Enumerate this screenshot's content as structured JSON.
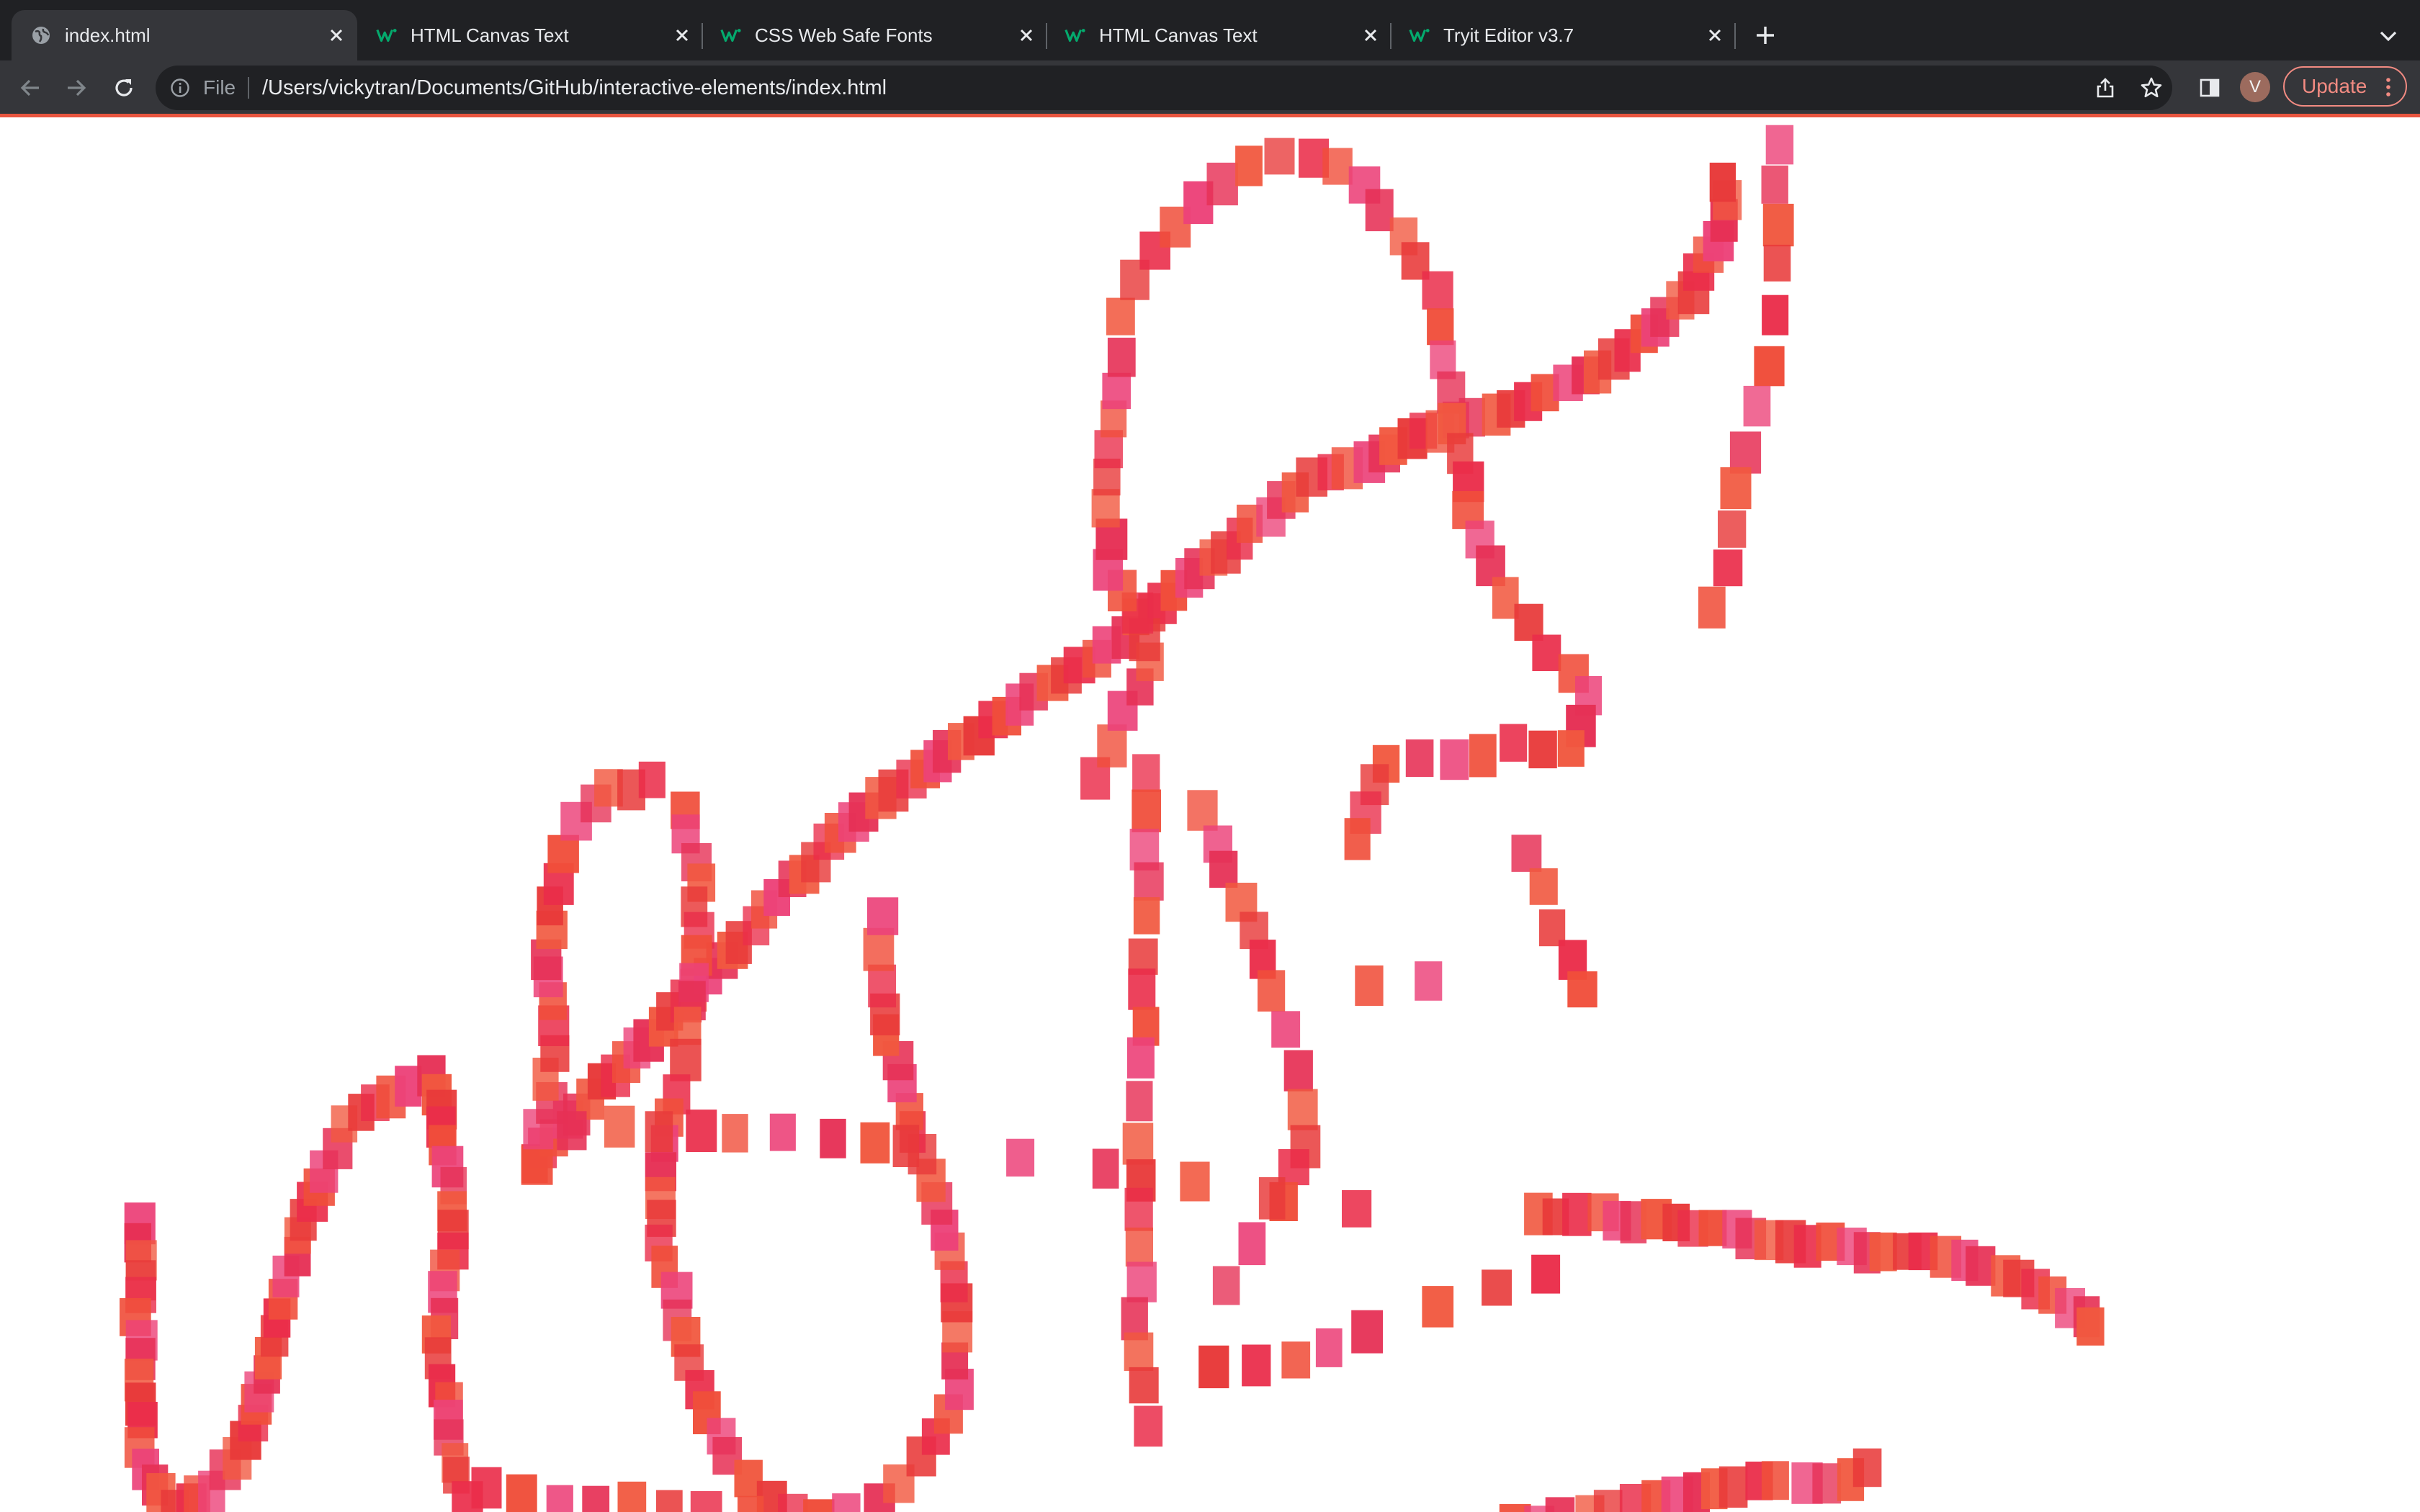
{
  "tabs": [
    {
      "title": "index.html",
      "favicon": "globe-icon",
      "active": true
    },
    {
      "title": "HTML Canvas Text",
      "favicon": "w3schools-icon",
      "active": false
    },
    {
      "title": "CSS Web Safe Fonts",
      "favicon": "w3schools-icon",
      "active": false
    },
    {
      "title": "HTML Canvas Text",
      "favicon": "w3schools-icon",
      "active": false
    },
    {
      "title": "Tryit Editor v3.7",
      "favicon": "w3schools-icon",
      "active": false
    }
  ],
  "toolbar": {
    "back_icon": "arrow-left-icon",
    "forward_icon": "arrow-right-icon",
    "reload_icon": "reload-icon",
    "scheme_label": "File",
    "url": "/Users/vickytran/Documents/GitHub/interactive-elements/index.html",
    "avatar_initial": "V",
    "update_label": "Update"
  },
  "colors": {
    "tabstrip": "#202124",
    "toolbar": "#35363a",
    "omnibox": "#202124",
    "accent": "#f28b82",
    "brand_w3": "#04aa6d",
    "stroke_palette": [
      "#e83a3a",
      "#ea2d4a",
      "#f04e3a",
      "#ec4279",
      "#e63055",
      "#f1583f"
    ]
  },
  "canvas_drawing": {
    "description_free": true,
    "shape": "scribble of translucent red-pink squares"
  }
}
